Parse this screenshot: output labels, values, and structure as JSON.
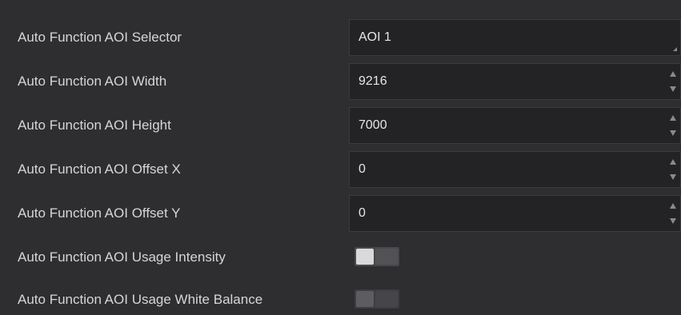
{
  "rows": [
    {
      "label": "Auto Function AOI Selector",
      "value": "AOI 1",
      "control": "dropdown"
    },
    {
      "label": "Auto Function AOI Width",
      "value": "9216",
      "control": "spinner"
    },
    {
      "label": "Auto Function AOI Height",
      "value": "7000",
      "control": "spinner"
    },
    {
      "label": "Auto Function AOI Offset X",
      "value": "0",
      "control": "spinner"
    },
    {
      "label": "Auto Function AOI Offset Y",
      "value": "0",
      "control": "spinner"
    },
    {
      "label": "Auto Function AOI Usage Intensity",
      "control": "toggle",
      "state": "off"
    },
    {
      "label": "Auto Function AOI Usage White Balance",
      "control": "toggle",
      "state": "disabled"
    }
  ],
  "icons": {
    "dropdown": "dropdown-corner-icon",
    "spinner_up": "arrow-up-icon",
    "spinner_down": "arrow-down-icon"
  },
  "colors": {
    "background": "#2e2e31",
    "field": "#232325",
    "label_text": "#d6d6d6",
    "value_text": "#e6e6e6"
  }
}
